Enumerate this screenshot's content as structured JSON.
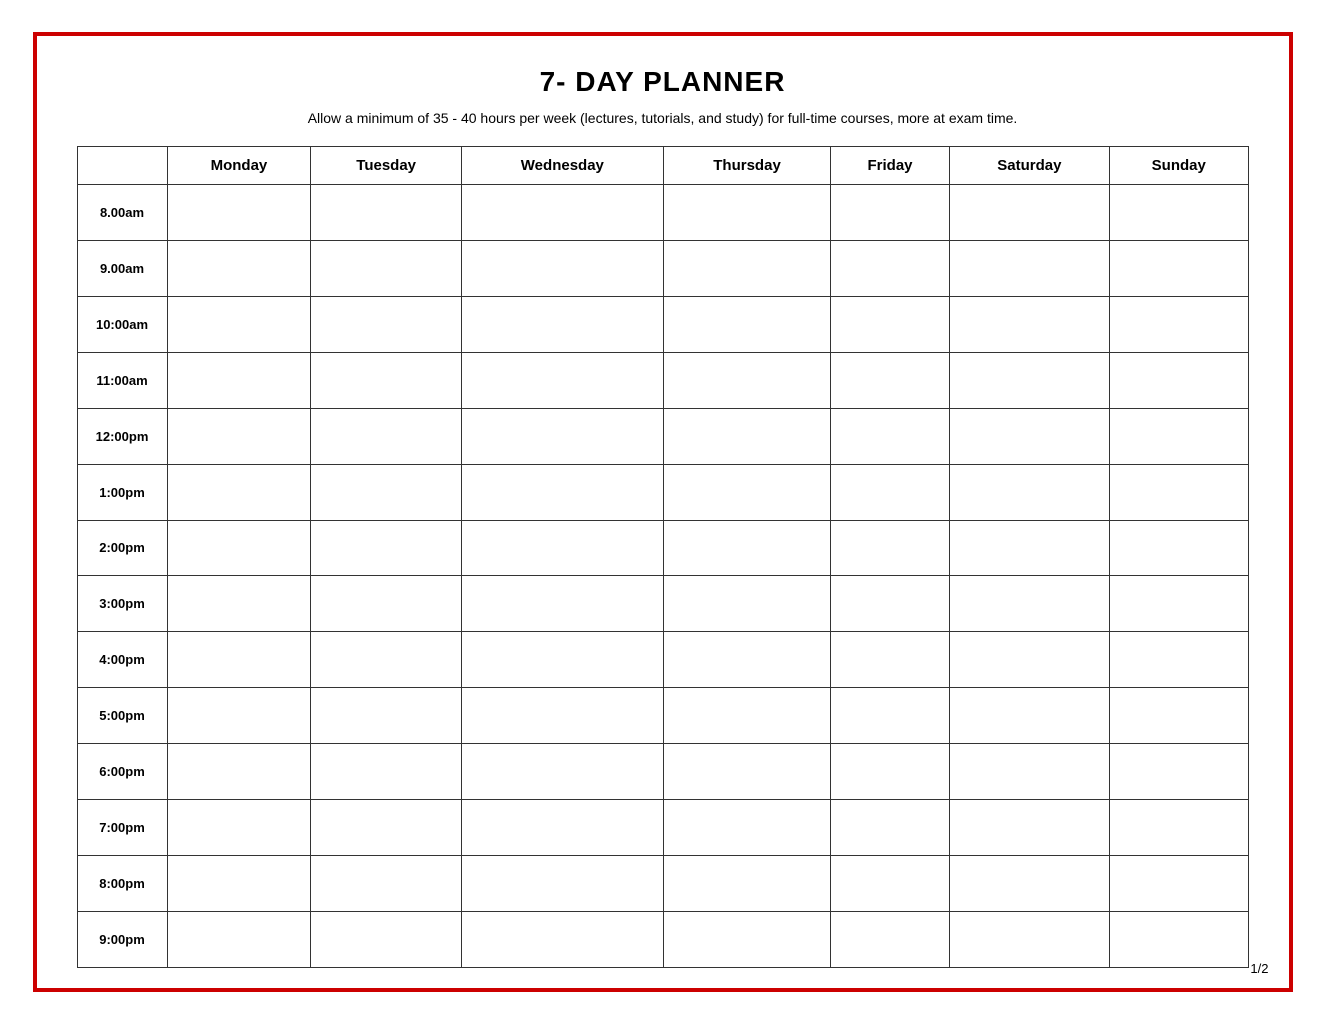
{
  "page": {
    "title": "7- DAY PLANNER",
    "subtitle": "Allow a minimum of 35 - 40 hours per week (lectures, tutorials, and study) for full-time courses, more at exam time.",
    "page_number": "1/2"
  },
  "table": {
    "days": [
      "Monday",
      "Tuesday",
      "Wednesday",
      "Thursday",
      "Friday",
      "Saturday",
      "Sunday"
    ],
    "times": [
      "8.00am",
      "9.00am",
      "10:00am",
      "11:00am",
      "12:00pm",
      "1:00pm",
      "2:00pm",
      "3:00pm",
      "4:00pm",
      "5:00pm",
      "6:00pm",
      "7:00pm",
      "8:00pm",
      "9:00pm"
    ]
  }
}
